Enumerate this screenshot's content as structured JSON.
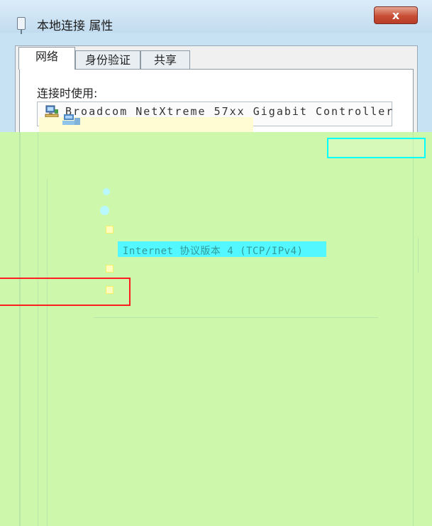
{
  "window": {
    "title": "本地连接 属性",
    "close_label": "x",
    "colors": {
      "title_bar": "#c7e2f3",
      "close_button": "#c84e35",
      "overlay": "#cdf7aa",
      "highlight": "#53f7ff",
      "red_box": "#ff1e1e"
    }
  },
  "tabs": [
    {
      "label": "网络",
      "active": true
    },
    {
      "label": "身份验证",
      "active": false
    },
    {
      "label": "共享",
      "active": false
    }
  ],
  "network": {
    "connect_using_label": "连接时使用:",
    "adapter_name": "Broadcom NetXtreme 57xx Gigabit Controller",
    "adapter_icon": "network-adapter-icon"
  },
  "overlay": {
    "highlight_text": "Internet 协议版本 4 (TCP/IPv4)"
  }
}
